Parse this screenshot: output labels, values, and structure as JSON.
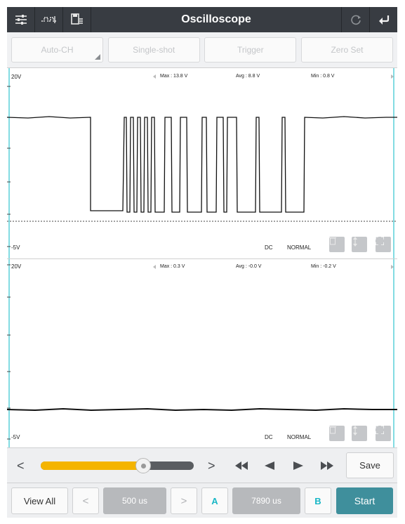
{
  "header": {
    "title": "Oscilloscope",
    "left_icons": [
      "settings-sliders-icon",
      "waveform-icon",
      "save-list-icon"
    ],
    "right_icons": [
      "refresh-icon",
      "back-icon"
    ]
  },
  "mode_buttons": [
    {
      "label": "Auto-CH"
    },
    {
      "label": "Single-shot"
    },
    {
      "label": "Trigger"
    },
    {
      "label": "Zero Set"
    }
  ],
  "channel1": {
    "top_label": "20V",
    "bottom_label": "-5V",
    "max": "Max : 13.8 V",
    "avg": "Avg : 8.8 V",
    "min": "Min : 0.8 V",
    "coupling": "DC",
    "mode": "NORMAL",
    "tools": [
      "delete-icon",
      "vertical-move-icon",
      "fullscreen-icon"
    ]
  },
  "channel2": {
    "top_label": "20V",
    "bottom_label": "-5V",
    "max": "Max : 0.3 V",
    "avg": "Avg : -0.0 V",
    "min": "Min : -0.2 V",
    "coupling": "DC",
    "mode": "NORMAL",
    "tools": [
      "delete-icon",
      "vertical-move-icon",
      "fullscreen-icon"
    ]
  },
  "playback": {
    "progress": 0.67,
    "prev_label": "<",
    "next_label": ">",
    "controls": [
      "fast-rewind-icon",
      "play-backward-icon",
      "play-forward-icon",
      "fast-forward-icon"
    ],
    "save_label": "Save"
  },
  "bottom": {
    "view_all_label": "View All",
    "timebase_prev": "<",
    "timebase": "500 us",
    "timebase_next": ">",
    "cursor_a": "A",
    "cursor_delta": "7890 us",
    "cursor_b": "B",
    "start_label": "Start"
  },
  "colors": {
    "header_bg": "#383c42",
    "accent": "#19b7c6",
    "start_bg": "#3f8f9c",
    "slider_fill": "#f4b400"
  }
}
